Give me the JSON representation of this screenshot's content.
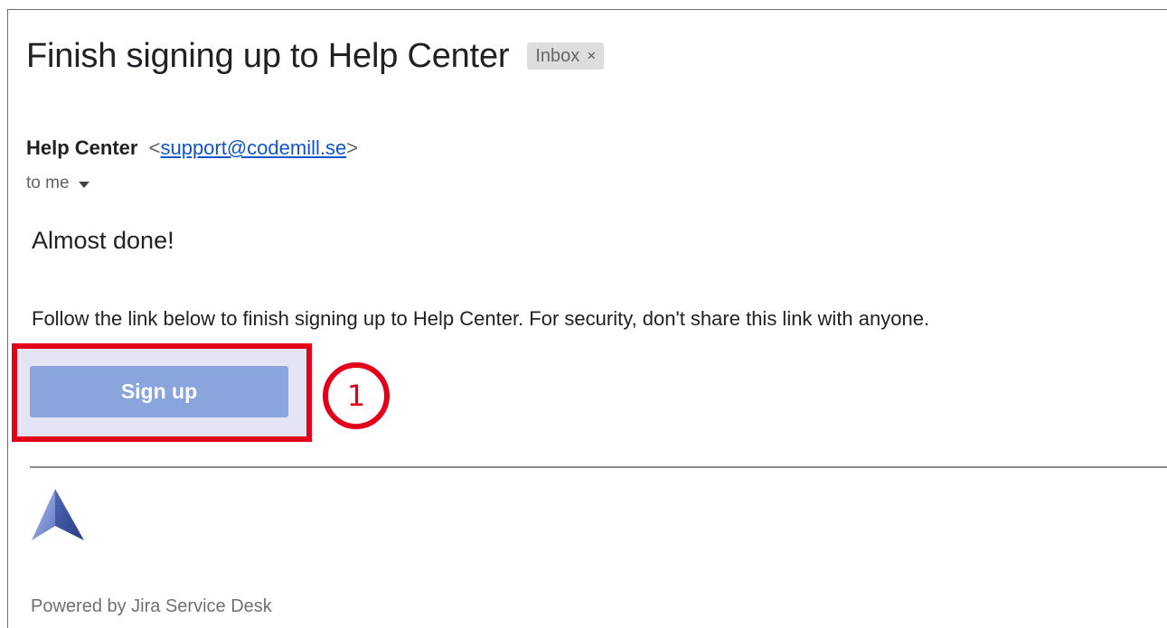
{
  "email": {
    "subject": "Finish signing up to Help Center",
    "label": "Inbox",
    "label_close": "×",
    "sender_name": "Help Center",
    "sender_email": "support@codemill.se",
    "sender_email_open": "<",
    "sender_email_close": ">",
    "recipient": "to me",
    "recipient_icon": "caret-down-icon"
  },
  "message": {
    "heading": "Almost done!",
    "body": "Follow the link below to finish signing up to Help Center. For security, don't share this link with anyone.",
    "button_label": "Sign up",
    "button_color": "#8aa4dc"
  },
  "annotation": {
    "step_number": "1",
    "highlight_color": "#e2001a"
  },
  "footer": {
    "logo_icon": "jira-service-desk-logo-icon",
    "text": "Powered by Jira Service Desk"
  }
}
